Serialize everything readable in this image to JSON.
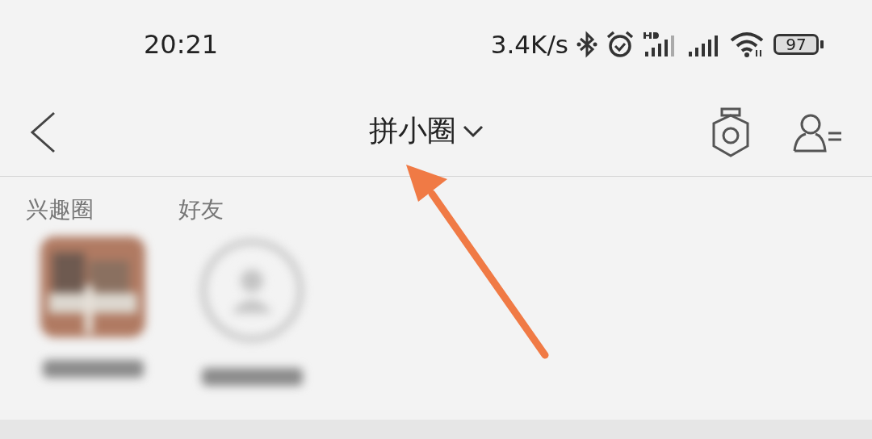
{
  "status_bar": {
    "time": "20:21",
    "speed": "3.4K/s",
    "battery": "97"
  },
  "header": {
    "title": "拼小圈"
  },
  "section": {
    "labels": [
      "兴趣圈",
      "好友"
    ]
  },
  "tiles": [
    {
      "kind": "picture"
    },
    {
      "kind": "avatar"
    }
  ]
}
